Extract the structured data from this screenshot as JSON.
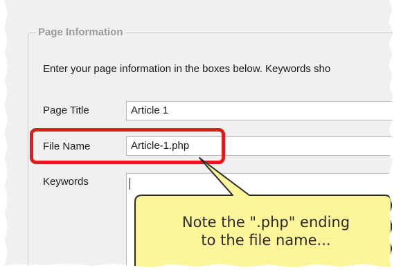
{
  "group": {
    "legend": "Page Information"
  },
  "intro_text": "Enter your page information in the boxes below.  Keywords sho",
  "fields": {
    "page_title": {
      "label": "Page Title",
      "value": "Article 1"
    },
    "file_name": {
      "label": "File Name",
      "value": "Article-1.php"
    },
    "keywords": {
      "label": "Keywords",
      "value": ""
    }
  },
  "callout": {
    "line1": "Note the \".php\" ending",
    "line2": "to the file name...",
    "fill_color": "#fdf59a",
    "border_color": "#2b2b2b"
  },
  "highlight": {
    "color": "#e01b1b"
  }
}
